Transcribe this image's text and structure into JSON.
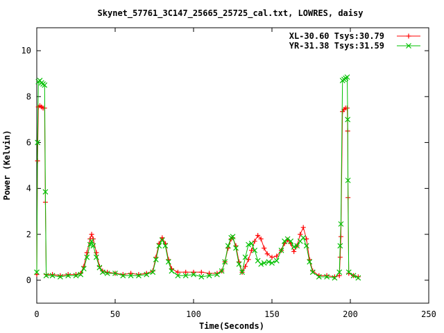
{
  "chart_data": {
    "type": "line",
    "title": "Skynet_57761_3C147_25665_25725_cal.txt, LOWRES, daisy",
    "xlabel": "Time(Seconds)",
    "ylabel": "Power (Kelvin)",
    "xlim": [
      0,
      250
    ],
    "ylim": [
      -1,
      11
    ],
    "xticks": [
      0,
      50,
      100,
      150,
      200,
      250
    ],
    "yticks": [
      0,
      2,
      4,
      6,
      8,
      10
    ],
    "grid": false,
    "legend_position": "top-right",
    "series": [
      {
        "name": "XL-30.60 Tsys:30.79",
        "color": "#ff0000",
        "marker": "plus",
        "points": [
          [
            0,
            0.25
          ],
          [
            0.5,
            5.2
          ],
          [
            1,
            7.55
          ],
          [
            2,
            7.6
          ],
          [
            3,
            7.55
          ],
          [
            4,
            7.5
          ],
          [
            5,
            7.5
          ],
          [
            5.5,
            3.4
          ],
          [
            6,
            0.25
          ],
          [
            10,
            0.25
          ],
          [
            15,
            0.2
          ],
          [
            20,
            0.25
          ],
          [
            25,
            0.25
          ],
          [
            28,
            0.3
          ],
          [
            30,
            0.6
          ],
          [
            32,
            1.2
          ],
          [
            34,
            1.8
          ],
          [
            35,
            2.0
          ],
          [
            36,
            1.8
          ],
          [
            38,
            1.2
          ],
          [
            40,
            0.6
          ],
          [
            42,
            0.4
          ],
          [
            45,
            0.35
          ],
          [
            50,
            0.3
          ],
          [
            55,
            0.25
          ],
          [
            60,
            0.3
          ],
          [
            65,
            0.25
          ],
          [
            70,
            0.3
          ],
          [
            74,
            0.4
          ],
          [
            76,
            1.0
          ],
          [
            78,
            1.6
          ],
          [
            80,
            1.85
          ],
          [
            82,
            1.6
          ],
          [
            84,
            0.9
          ],
          [
            86,
            0.5
          ],
          [
            90,
            0.35
          ],
          [
            95,
            0.35
          ],
          [
            100,
            0.35
          ],
          [
            105,
            0.35
          ],
          [
            110,
            0.3
          ],
          [
            115,
            0.3
          ],
          [
            118,
            0.4
          ],
          [
            120,
            0.8
          ],
          [
            122,
            1.4
          ],
          [
            124,
            1.8
          ],
          [
            125,
            1.85
          ],
          [
            127,
            1.5
          ],
          [
            129,
            0.8
          ],
          [
            131,
            0.35
          ],
          [
            133,
            0.6
          ],
          [
            135,
            0.9
          ],
          [
            137,
            1.3
          ],
          [
            139,
            1.7
          ],
          [
            141,
            1.95
          ],
          [
            143,
            1.8
          ],
          [
            145,
            1.4
          ],
          [
            147,
            1.15
          ],
          [
            150,
            1.0
          ],
          [
            153,
            1.05
          ],
          [
            156,
            1.3
          ],
          [
            158,
            1.6
          ],
          [
            160,
            1.75
          ],
          [
            162,
            1.6
          ],
          [
            164,
            1.25
          ],
          [
            166,
            1.5
          ],
          [
            168,
            2.0
          ],
          [
            170,
            2.3
          ],
          [
            172,
            1.8
          ],
          [
            174,
            0.9
          ],
          [
            176,
            0.4
          ],
          [
            180,
            0.2
          ],
          [
            185,
            0.2
          ],
          [
            190,
            0.15
          ],
          [
            193,
            0.2
          ],
          [
            193.5,
            1.0
          ],
          [
            194,
            1.9
          ],
          [
            195,
            7.35
          ],
          [
            196,
            7.45
          ],
          [
            197,
            7.5
          ],
          [
            198,
            7.5
          ],
          [
            198.3,
            6.5
          ],
          [
            198.5,
            3.6
          ],
          [
            199,
            0.3
          ],
          [
            202,
            0.2
          ],
          [
            205,
            0.15
          ]
        ]
      },
      {
        "name": "YR-31.38 Tsys:31.59",
        "color": "#00c000",
        "marker": "cross",
        "points": [
          [
            0,
            0.35
          ],
          [
            0.5,
            6.0
          ],
          [
            1,
            8.65
          ],
          [
            2,
            8.7
          ],
          [
            3,
            8.6
          ],
          [
            4,
            8.55
          ],
          [
            5,
            8.5
          ],
          [
            5.5,
            3.85
          ],
          [
            6,
            0.2
          ],
          [
            10,
            0.2
          ],
          [
            15,
            0.15
          ],
          [
            20,
            0.2
          ],
          [
            25,
            0.2
          ],
          [
            28,
            0.25
          ],
          [
            30,
            0.5
          ],
          [
            32,
            1.0
          ],
          [
            34,
            1.55
          ],
          [
            35,
            1.7
          ],
          [
            36,
            1.5
          ],
          [
            38,
            1.0
          ],
          [
            40,
            0.55
          ],
          [
            42,
            0.35
          ],
          [
            45,
            0.3
          ],
          [
            50,
            0.3
          ],
          [
            55,
            0.2
          ],
          [
            60,
            0.2
          ],
          [
            65,
            0.2
          ],
          [
            70,
            0.25
          ],
          [
            74,
            0.35
          ],
          [
            76,
            0.9
          ],
          [
            78,
            1.5
          ],
          [
            80,
            1.75
          ],
          [
            82,
            1.5
          ],
          [
            84,
            0.8
          ],
          [
            86,
            0.4
          ],
          [
            90,
            0.2
          ],
          [
            95,
            0.2
          ],
          [
            100,
            0.25
          ],
          [
            105,
            0.15
          ],
          [
            110,
            0.2
          ],
          [
            115,
            0.25
          ],
          [
            118,
            0.4
          ],
          [
            120,
            0.8
          ],
          [
            122,
            1.5
          ],
          [
            124,
            1.85
          ],
          [
            125,
            1.9
          ],
          [
            127,
            1.4
          ],
          [
            129,
            0.7
          ],
          [
            131,
            0.35
          ],
          [
            133,
            1.0
          ],
          [
            135,
            1.55
          ],
          [
            137,
            1.6
          ],
          [
            139,
            1.3
          ],
          [
            141,
            0.85
          ],
          [
            143,
            0.7
          ],
          [
            145,
            0.75
          ],
          [
            148,
            0.8
          ],
          [
            150,
            0.75
          ],
          [
            153,
            0.85
          ],
          [
            156,
            1.3
          ],
          [
            158,
            1.7
          ],
          [
            160,
            1.8
          ],
          [
            162,
            1.7
          ],
          [
            164,
            1.45
          ],
          [
            166,
            1.5
          ],
          [
            168,
            1.7
          ],
          [
            170,
            1.85
          ],
          [
            172,
            1.5
          ],
          [
            174,
            0.8
          ],
          [
            176,
            0.35
          ],
          [
            180,
            0.15
          ],
          [
            185,
            0.15
          ],
          [
            190,
            0.1
          ],
          [
            193,
            0.35
          ],
          [
            193.5,
            1.5
          ],
          [
            194,
            2.45
          ],
          [
            195,
            8.7
          ],
          [
            196,
            8.75
          ],
          [
            197,
            8.8
          ],
          [
            198,
            8.85
          ],
          [
            198.3,
            7.0
          ],
          [
            198.5,
            4.35
          ],
          [
            199,
            0.35
          ],
          [
            202,
            0.2
          ],
          [
            205,
            0.1
          ]
        ]
      }
    ]
  }
}
